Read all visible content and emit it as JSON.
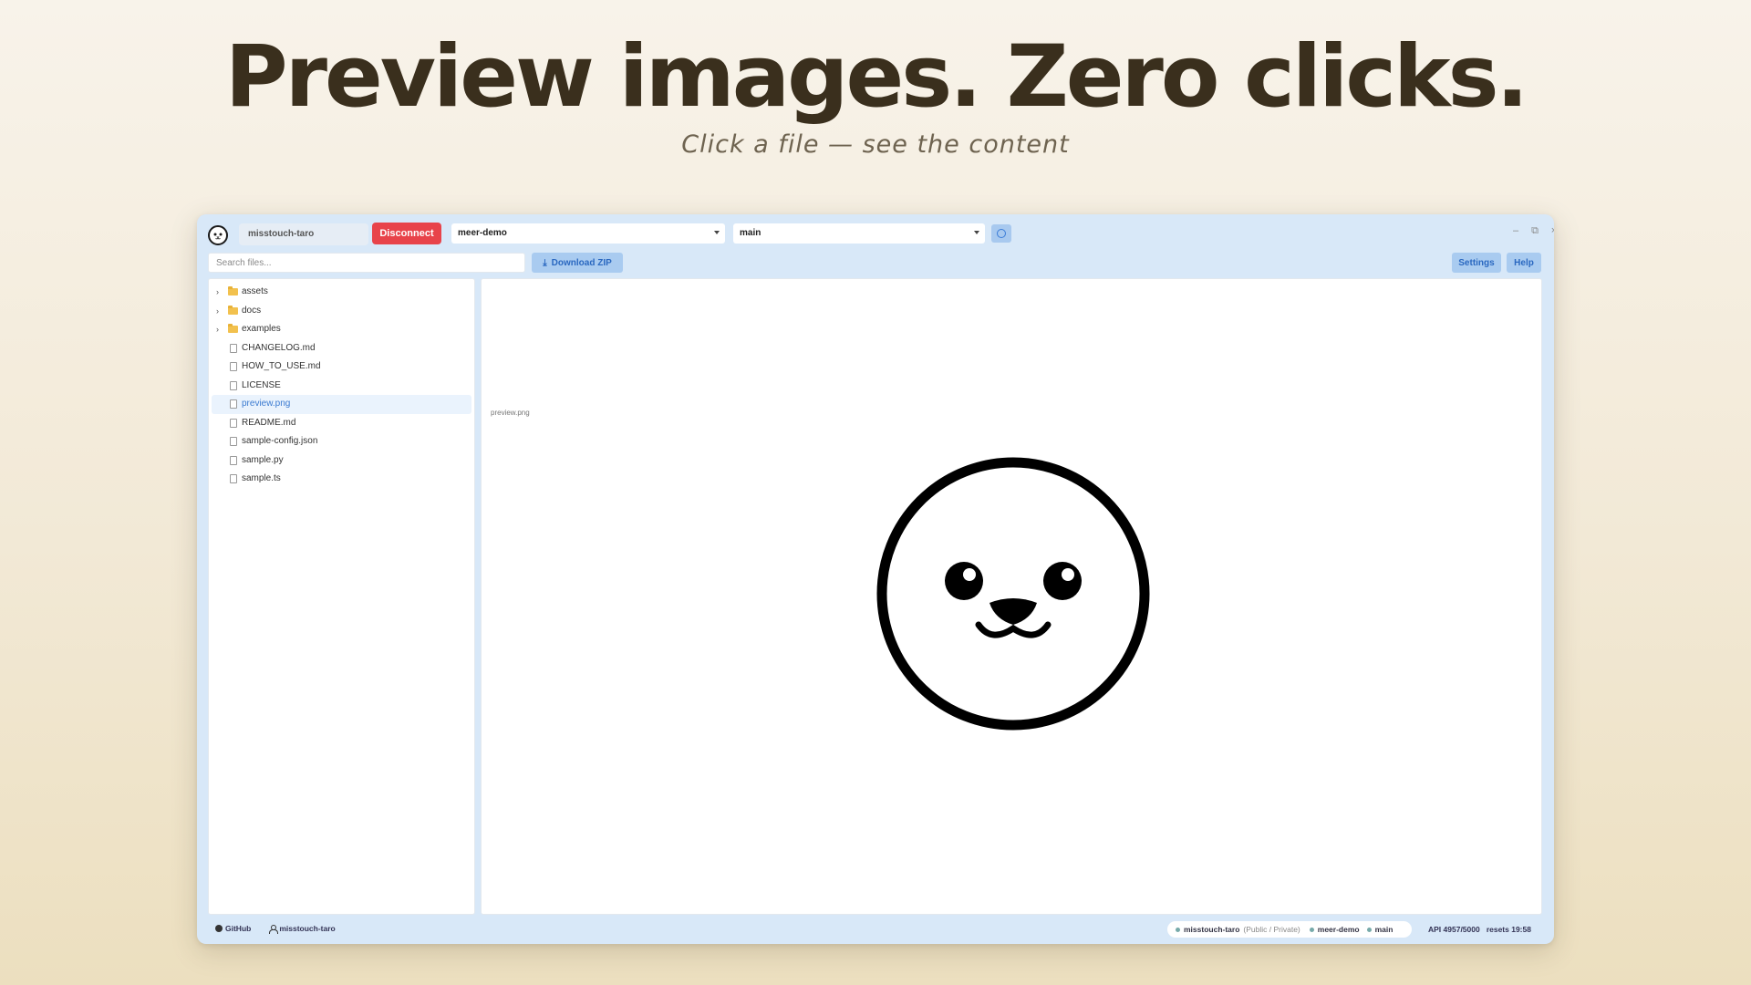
{
  "hero": {
    "title": "Preview images. Zero clicks.",
    "subtitle": "Click a file — see the content"
  },
  "toolbar": {
    "username": "misstouch-taro",
    "disconnect_label": "Disconnect",
    "repo": "meer-demo",
    "branch": "main",
    "search_placeholder": "Search files...",
    "download_label": "Download ZIP",
    "settings_label": "Settings",
    "help_label": "Help"
  },
  "window_controls": {
    "minimize": "–",
    "restore": "⧉",
    "close": "×"
  },
  "tree": {
    "items": [
      {
        "name": "assets",
        "type": "folder"
      },
      {
        "name": "docs",
        "type": "folder"
      },
      {
        "name": "examples",
        "type": "folder"
      },
      {
        "name": "CHANGELOG.md",
        "type": "file"
      },
      {
        "name": "HOW_TO_USE.md",
        "type": "file"
      },
      {
        "name": "LICENSE",
        "type": "file"
      },
      {
        "name": "preview.png",
        "type": "file",
        "selected": true
      },
      {
        "name": "README.md",
        "type": "file"
      },
      {
        "name": "sample-config.json",
        "type": "file"
      },
      {
        "name": "sample.py",
        "type": "file"
      },
      {
        "name": "sample.ts",
        "type": "file"
      }
    ]
  },
  "viewer": {
    "filename": "preview.png",
    "image_icon": "seal-face-icon"
  },
  "statusbar": {
    "github_label": "GitHub",
    "user_label": "misstouch-taro",
    "pill_user": "misstouch-taro",
    "pill_visibility": "(Public / Private)",
    "pill_repo": "meer-demo",
    "pill_branch": "main",
    "api": "API 4957/5000",
    "resets": "resets 19:58"
  },
  "colors": {
    "accent": "#3b7dd8",
    "danger": "#e8434a",
    "window_bg": "#d8e8f8",
    "folder": "#f2c14e"
  }
}
